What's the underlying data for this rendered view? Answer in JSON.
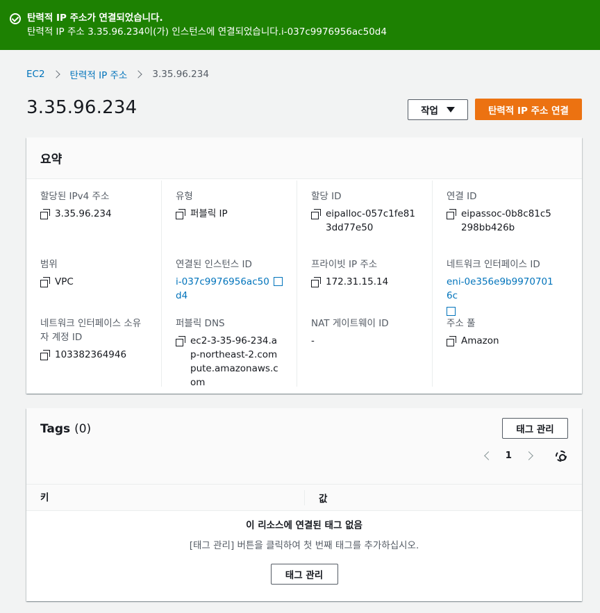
{
  "flash": {
    "title": "탄력적 IP 주소가 연결되었습니다.",
    "message": "탄력적 IP 주소 3.35.96.234이(가) 인스턴스에 연결되었습니다.i-037c9976956ac50d4"
  },
  "breadcrumb": {
    "items": [
      "EC2",
      "탄력적 IP 주소",
      "3.35.96.234"
    ]
  },
  "page": {
    "title": "3.35.96.234",
    "actions_label": "작업",
    "associate_label": "탄력적 IP 주소 연결"
  },
  "summary": {
    "heading": "요약",
    "columns": [
      [
        {
          "label": "할당된 IPv4 주소",
          "value": "3.35.96.234"
        },
        {
          "label": "범위",
          "value": "VPC"
        },
        {
          "label": "네트워크 인터페이스 소유자 계정 ID",
          "value": "103382364946"
        }
      ],
      [
        {
          "label": "유형",
          "value": "퍼블릭 IP"
        },
        {
          "label": "연결된 인스턴스 ID",
          "value": "i-037c9976956ac50d4"
        },
        {
          "label": "퍼블릭 DNS",
          "value": "ec2-3-35-96-234.ap-northeast-2.compute.amazonaws.com"
        }
      ],
      [
        {
          "label": "할당 ID",
          "value": "eipalloc-057c1fe813dd77e50"
        },
        {
          "label": "프라이빗 IP 주소",
          "value": "172.31.15.14"
        },
        {
          "label": "NAT 게이트웨이 ID",
          "value": "-"
        }
      ],
      [
        {
          "label": "연결 ID",
          "value": "eipassoc-0b8c81c5298bb426b"
        },
        {
          "label": "네트워크 인터페이스 ID",
          "value": "eni-0e356e9b99707016c"
        },
        {
          "label": "주소 풀",
          "value": "Amazon"
        }
      ]
    ]
  },
  "tags": {
    "title": "Tags",
    "count": "(0)",
    "manage_label": "태그 관리",
    "page_number": "1",
    "col_key": "키",
    "col_value": "값",
    "empty_title": "이 리소스에 연결된 태그 없음",
    "empty_desc": "[태그 관리] 버튼을 클릭하여 첫 번째 태그를 추가하십시오.",
    "empty_button": "태그 관리"
  },
  "colors": {
    "success": "#1d8102",
    "primary": "#ec7211",
    "link": "#0073bb"
  }
}
